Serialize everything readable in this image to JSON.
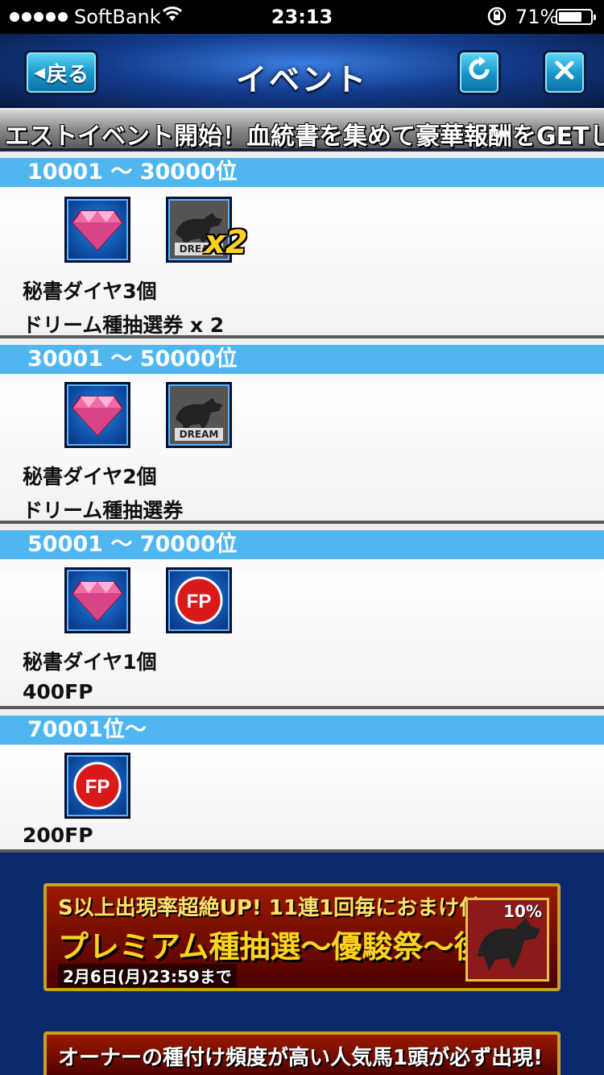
{
  "status_bar": {
    "carrier": "SoftBank",
    "time": "23:13",
    "battery_percent": "71%"
  },
  "header": {
    "back_label": "戻る",
    "title": "イベント"
  },
  "marquee": {
    "text": "エストイベント開始！血統書を集めて豪華報酬をGETしよ"
  },
  "sections": [
    {
      "rank": "10001 〜 30000位",
      "rewards": [
        "秘書ダイヤ3個",
        "ドリーム種抽選券 x 2"
      ],
      "icons": [
        "diamond-icon",
        "dream-ticket-icon"
      ],
      "multiplier": "x2",
      "dream_tag": "DREAM"
    },
    {
      "rank": "30001 〜 50000位",
      "rewards": [
        "秘書ダイヤ2個",
        "ドリーム種抽選券"
      ],
      "icons": [
        "diamond-icon",
        "dream-ticket-icon"
      ],
      "dream_tag": "DREAM"
    },
    {
      "rank": "50001 〜 70000位",
      "rewards": [
        "秘書ダイヤ1個",
        "400FP"
      ],
      "icons": [
        "diamond-icon",
        "fp-coin-icon"
      ],
      "fp_label": "FP"
    },
    {
      "rank": "70001位〜",
      "rewards": [
        "200FP"
      ],
      "icons": [
        "fp-coin-icon"
      ],
      "fp_label": "FP"
    }
  ],
  "banners": [
    {
      "line1": "S以上出現率超絶UP! 11連1回毎におまけ付!!",
      "line2": "プレミアム種抽選〜優駿祭〜後半",
      "line3": "2月6日(月)23:59まで",
      "badge_text": "10%"
    },
    {
      "line1": "オーナーの種付け頻度が高い人気馬1頭が必ず出現!"
    }
  ],
  "colors": {
    "rank_bar": "#4fb6f0",
    "background": "#0b2a6e",
    "button": "#1693c9"
  }
}
